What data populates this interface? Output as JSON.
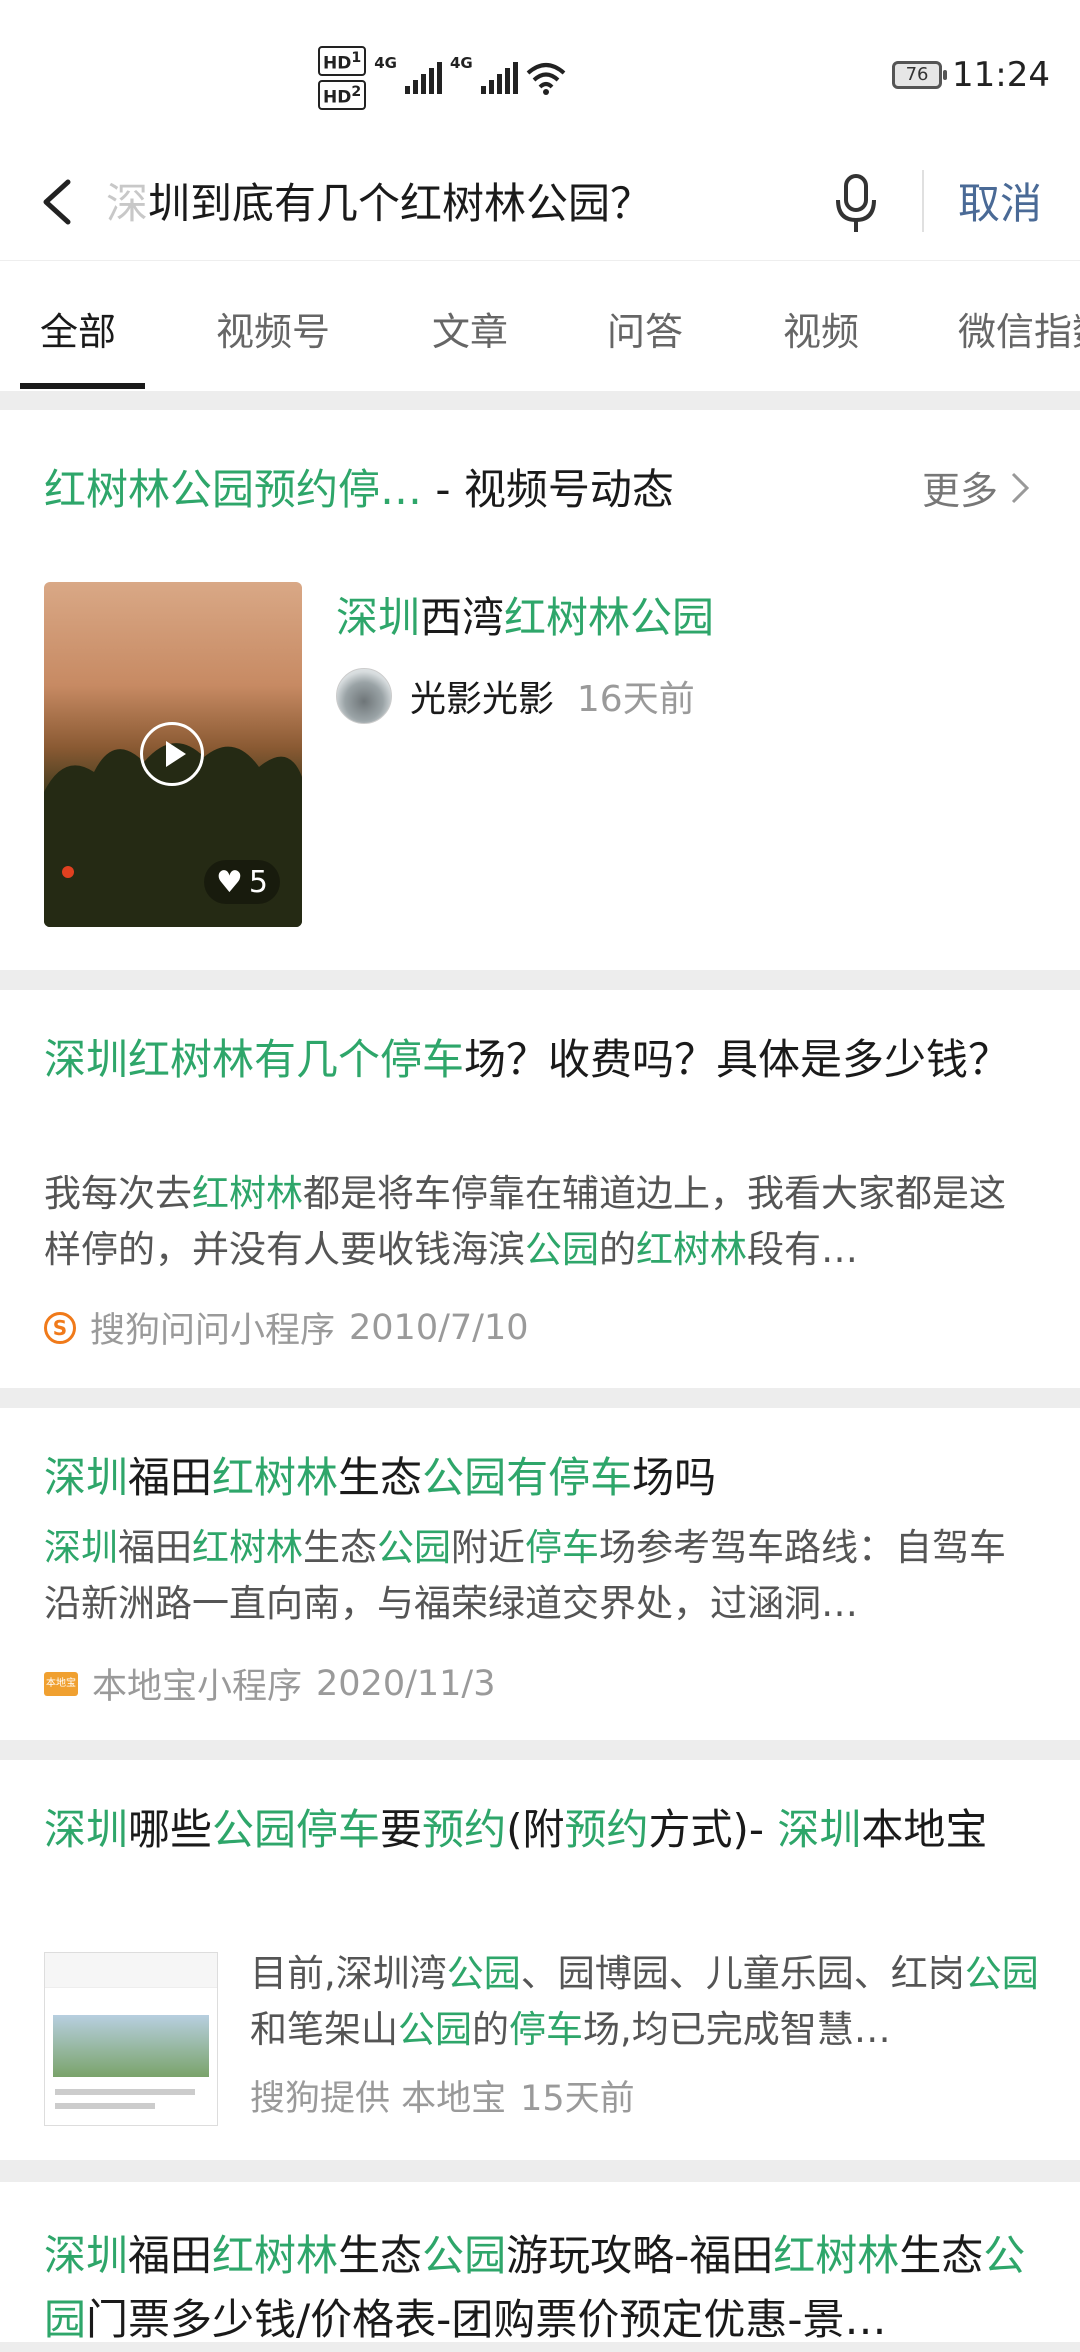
{
  "status_bar": {
    "hd1": "HD",
    "hd1_sub": "1",
    "hd2": "HD",
    "hd2_sub": "2",
    "net1": "4G",
    "net2": "4G",
    "battery": "76",
    "time": "11:24"
  },
  "search": {
    "query": "圳到底有几个红树林公园？",
    "query_faded_char": "深",
    "cancel_label": "取消"
  },
  "tabs": [
    {
      "label": "全部",
      "active": true
    },
    {
      "label": "视频号"
    },
    {
      "label": "文章"
    },
    {
      "label": "问答"
    },
    {
      "label": "视频"
    },
    {
      "label": "微信指数"
    }
  ],
  "video_section": {
    "title_highlight": "红树林公园预约停…",
    "title_suffix": " - 视频号动态",
    "more_label": "更多",
    "item": {
      "title": [
        {
          "t": "深圳",
          "hl": true
        },
        {
          "t": "西湾",
          "hl": false
        },
        {
          "t": "红树林公园",
          "hl": true
        }
      ],
      "author": "光影光影",
      "time": "16天前",
      "likes": "5"
    }
  },
  "results": [
    {
      "title": [
        {
          "t": "深圳红树林有几个停车",
          "hl": true
        },
        {
          "t": "场？收费吗？具体是多少钱？",
          "hl": false
        }
      ],
      "desc": [
        {
          "t": "我每次去",
          "hl": false
        },
        {
          "t": "红树林",
          "hl": true
        },
        {
          "t": "都是将车停靠在辅道边上，我看大家都是这样停的，并没有人要收钱海滨",
          "hl": false
        },
        {
          "t": "公园",
          "hl": true
        },
        {
          "t": "的",
          "hl": false
        },
        {
          "t": "红树林",
          "hl": true
        },
        {
          "t": "段有…",
          "hl": false
        }
      ],
      "source": "搜狗问问小程序",
      "date": "2010/7/10"
    },
    {
      "title": [
        {
          "t": "深圳",
          "hl": true
        },
        {
          "t": "福田",
          "hl": false
        },
        {
          "t": "红树林",
          "hl": true
        },
        {
          "t": "生态",
          "hl": false
        },
        {
          "t": "公园有停车",
          "hl": true
        },
        {
          "t": "场吗",
          "hl": false
        }
      ],
      "desc": [
        {
          "t": "深圳",
          "hl": true
        },
        {
          "t": "福田",
          "hl": false
        },
        {
          "t": "红树林",
          "hl": true
        },
        {
          "t": "生态",
          "hl": false
        },
        {
          "t": "公园",
          "hl": true
        },
        {
          "t": "附近",
          "hl": false
        },
        {
          "t": "停车",
          "hl": true
        },
        {
          "t": "场参考驾车路线：自驾车沿新洲路一直向南，与福荣绿道交界处，过涵洞…",
          "hl": false
        }
      ],
      "source": "本地宝小程序",
      "date": "2020/11/3"
    },
    {
      "title": [
        {
          "t": "深圳",
          "hl": true
        },
        {
          "t": "哪些",
          "hl": false
        },
        {
          "t": "公园停车",
          "hl": true
        },
        {
          "t": "要",
          "hl": false
        },
        {
          "t": "预约",
          "hl": true
        },
        {
          "t": "(附",
          "hl": false
        },
        {
          "t": "预约",
          "hl": true
        },
        {
          "t": "方式)- ",
          "hl": false
        },
        {
          "t": "深圳",
          "hl": true
        },
        {
          "t": "本地宝",
          "hl": false
        }
      ],
      "desc": [
        {
          "t": "目前,深圳湾",
          "hl": false
        },
        {
          "t": "公园",
          "hl": true
        },
        {
          "t": "、园博园、儿童乐园、红岗",
          "hl": false
        },
        {
          "t": "公园",
          "hl": true
        },
        {
          "t": "和笔架山",
          "hl": false
        },
        {
          "t": "公园",
          "hl": true
        },
        {
          "t": "的",
          "hl": false
        },
        {
          "t": "停车",
          "hl": true
        },
        {
          "t": "场,均已完成智慧…",
          "hl": false
        }
      ],
      "source": "搜狗提供 本地宝",
      "date": "15天前"
    },
    {
      "title": [
        {
          "t": "深圳",
          "hl": true
        },
        {
          "t": "福田",
          "hl": false
        },
        {
          "t": "红树林",
          "hl": true
        },
        {
          "t": "生态",
          "hl": false
        },
        {
          "t": "公园",
          "hl": true
        },
        {
          "t": "游玩攻略-福田",
          "hl": false
        },
        {
          "t": "红树林",
          "hl": true
        },
        {
          "t": "生态",
          "hl": false
        },
        {
          "t": "公园",
          "hl": true
        },
        {
          "t": "门票多少钱/价格表-团购票价预定优惠-景…",
          "hl": false
        }
      ]
    }
  ],
  "colors": {
    "highlight": "#2ea66a",
    "cancel": "#4a6a96",
    "background": "#ededed"
  }
}
